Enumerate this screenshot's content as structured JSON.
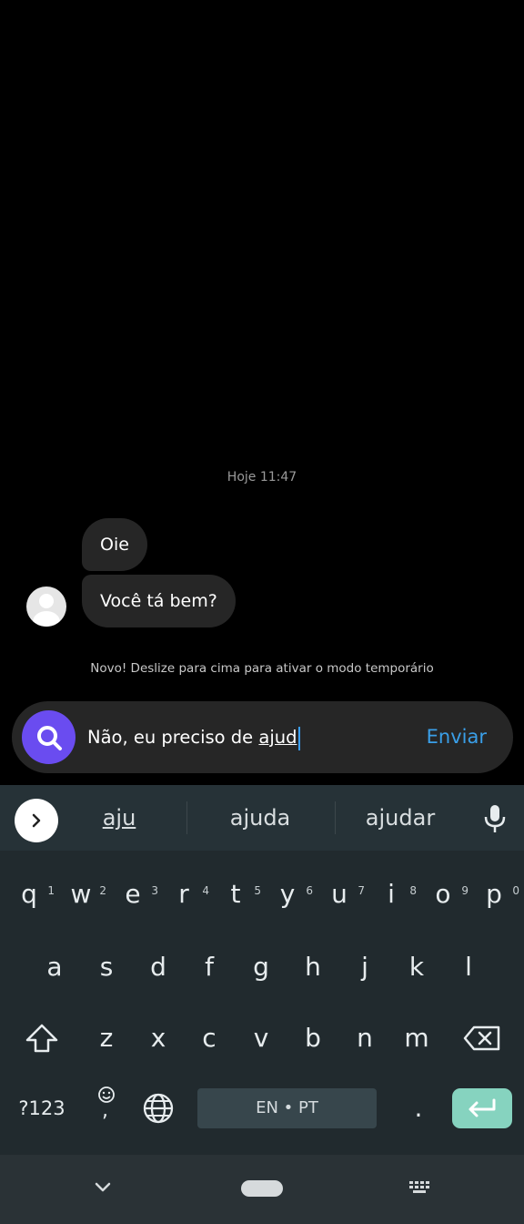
{
  "chat": {
    "timestamp": "Hoje 11:47",
    "messages": [
      {
        "text": "Oie"
      },
      {
        "text": "Você tá bem?"
      }
    ],
    "temporary_mode_hint": "Novo! Deslize para cima para ativar o modo temporário"
  },
  "composer": {
    "typed_prefix": "Não, eu preciso de ",
    "typed_composing": "ajud",
    "send_label": "Enviar",
    "search_color": "#6a4cf0",
    "send_color": "#3a9fe8"
  },
  "keyboard": {
    "suggestions": [
      "aju",
      "ajuda",
      "ajudar"
    ],
    "row1": [
      {
        "key": "q",
        "num": "1"
      },
      {
        "key": "w",
        "num": "2"
      },
      {
        "key": "e",
        "num": "3"
      },
      {
        "key": "r",
        "num": "4"
      },
      {
        "key": "t",
        "num": "5"
      },
      {
        "key": "y",
        "num": "6"
      },
      {
        "key": "u",
        "num": "7"
      },
      {
        "key": "i",
        "num": "8"
      },
      {
        "key": "o",
        "num": "9"
      },
      {
        "key": "p",
        "num": "0"
      }
    ],
    "row2": [
      "a",
      "s",
      "d",
      "f",
      "g",
      "h",
      "j",
      "k",
      "l"
    ],
    "row3": [
      "z",
      "x",
      "c",
      "v",
      "b",
      "n",
      "m"
    ],
    "symbols_label": "?123",
    "emoji_comma": ",",
    "space_label": "EN • PT",
    "period": ".",
    "enter_color": "#86d3bf",
    "icons": [
      "chevron-right-icon",
      "mic-icon",
      "shift-icon",
      "backspace-icon",
      "emoji-icon",
      "globe-icon",
      "enter-icon"
    ]
  },
  "navbar": {
    "icons": [
      "chevron-down-icon",
      "home-pill",
      "keyboard-icon"
    ]
  }
}
